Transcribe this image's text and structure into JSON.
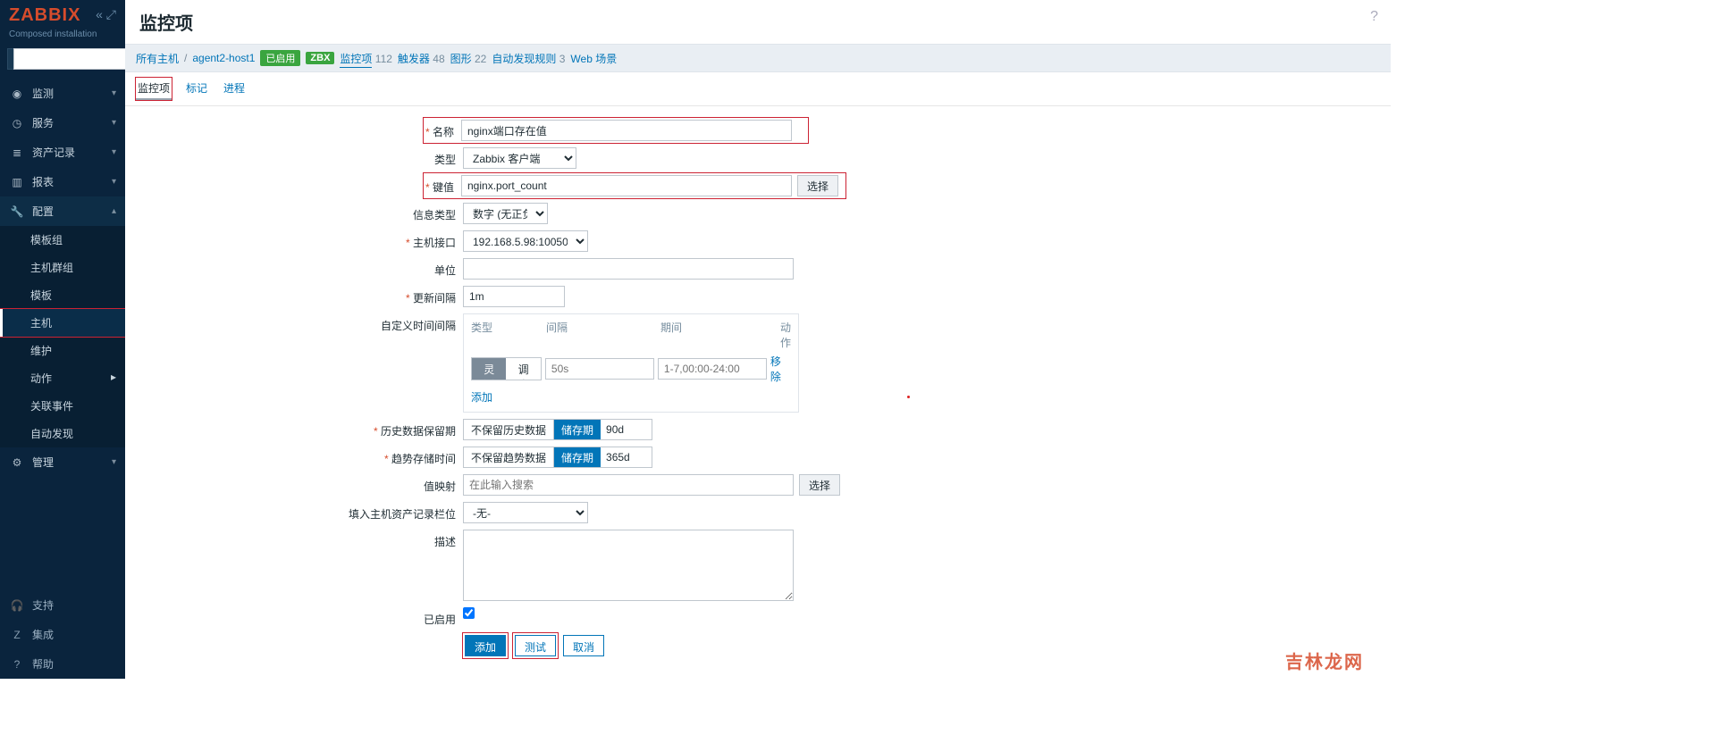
{
  "logo": "ZABBIX",
  "logo_sub": "Composed installation",
  "search": {
    "placeholder": ""
  },
  "nav": {
    "monitoring": "监测",
    "services": "服务",
    "inventory": "资产记录",
    "reports": "报表",
    "config": "配置",
    "config_items": {
      "template_groups": "模板组",
      "host_groups": "主机群组",
      "templates": "模板",
      "hosts": "主机",
      "maintenance": "维护",
      "actions": "动作",
      "correlation": "关联事件",
      "discovery": "自动发现"
    },
    "admin": "管理",
    "support": "支持",
    "integrations": "集成",
    "help": "帮助"
  },
  "page_title": "监控项",
  "filterbar": {
    "all_hosts": "所有主机",
    "host": "agent2-host1",
    "enabled": "已启用",
    "zbx": "ZBX",
    "items": {
      "label": "监控项",
      "count": "112"
    },
    "triggers": {
      "label": "触发器",
      "count": "48"
    },
    "graphs": {
      "label": "图形",
      "count": "22"
    },
    "discovery": {
      "label": "自动发现规则",
      "count": "3"
    },
    "web": "Web 场景"
  },
  "tabs": {
    "item": "监控项",
    "tags": "标记",
    "process": "进程"
  },
  "form": {
    "name": {
      "label": "名称",
      "value": "nginx端口存在值"
    },
    "type": {
      "label": "类型",
      "value": "Zabbix 客户端"
    },
    "key": {
      "label": "键值",
      "value": "nginx.port_count",
      "select": "选择"
    },
    "info_type": {
      "label": "信息类型",
      "value": "数字 (无正负)"
    },
    "interface": {
      "label": "主机接口",
      "value": "192.168.5.98:10050"
    },
    "units": {
      "label": "单位",
      "value": ""
    },
    "update_interval": {
      "label": "更新间隔",
      "value": "1m"
    },
    "custom_intervals": {
      "label": "自定义时间间隔",
      "h_type": "类型",
      "h_interval": "间隔",
      "h_period": "期间",
      "h_action": "动作",
      "flex": "灵活",
      "sched": "调度",
      "ph_interval": "50s",
      "ph_period": "1-7,00:00-24:00",
      "remove": "移除",
      "add": "添加"
    },
    "history": {
      "label": "历史数据保留期",
      "nostore": "不保留历史数据",
      "store": "储存期",
      "value": "90d"
    },
    "trends": {
      "label": "趋势存储时间",
      "nostore": "不保留趋势数据",
      "store": "储存期",
      "value": "365d"
    },
    "valuemap": {
      "label": "值映射",
      "placeholder": "在此输入搜索",
      "select": "选择"
    },
    "inventory": {
      "label": "填入主机资产记录栏位",
      "value": "-无-"
    },
    "description": {
      "label": "描述",
      "value": ""
    },
    "enabled": {
      "label": "已启用"
    },
    "buttons": {
      "add": "添加",
      "test": "测试",
      "cancel": "取消"
    }
  },
  "watermark": "吉林龙网"
}
